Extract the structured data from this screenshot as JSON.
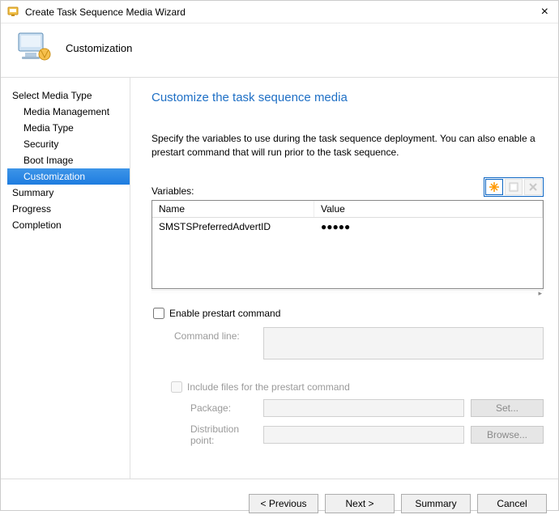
{
  "window": {
    "title": "Create Task Sequence Media Wizard"
  },
  "header": {
    "page_title": "Customization"
  },
  "sidebar": {
    "items": [
      {
        "label": "Select Media Type",
        "sub": false,
        "selected": false
      },
      {
        "label": "Media Management",
        "sub": true,
        "selected": false
      },
      {
        "label": "Media Type",
        "sub": true,
        "selected": false
      },
      {
        "label": "Security",
        "sub": true,
        "selected": false
      },
      {
        "label": "Boot Image",
        "sub": true,
        "selected": false
      },
      {
        "label": "Customization",
        "sub": true,
        "selected": true
      },
      {
        "label": "Summary",
        "sub": false,
        "selected": false
      },
      {
        "label": "Progress",
        "sub": false,
        "selected": false
      },
      {
        "label": "Completion",
        "sub": false,
        "selected": false
      }
    ]
  },
  "main": {
    "heading": "Customize the task sequence media",
    "description": "Specify the variables to use during the task sequence deployment. You can also enable a prestart command that will run prior to the task sequence.",
    "variables_label": "Variables:",
    "table": {
      "col_name": "Name",
      "col_value": "Value",
      "rows": [
        {
          "name": "SMSTSPreferredAdvertID",
          "value": "●●●●●"
        }
      ]
    },
    "enable_prestart_label": "Enable prestart command",
    "enable_prestart_checked": false,
    "cmdline_label": "Command line:",
    "cmdline_value": "",
    "include_files_label": "Include files for the prestart command",
    "include_files_checked": false,
    "package_label": "Package:",
    "package_value": "",
    "set_button": "Set...",
    "dist_point_label": "Distribution point:",
    "dist_point_value": "",
    "browse_button": "Browse..."
  },
  "footer": {
    "previous": "< Previous",
    "next": "Next >",
    "summary": "Summary",
    "cancel": "Cancel"
  }
}
